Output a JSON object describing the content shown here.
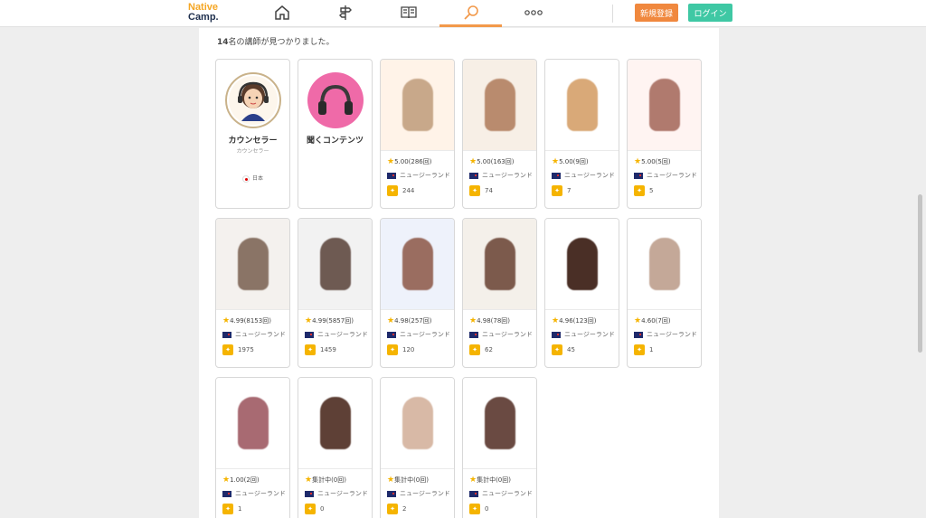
{
  "logo": {
    "line1": "Native",
    "line2": "Camp."
  },
  "nav": {
    "icons": [
      "home-icon",
      "signpost-icon",
      "book-icon",
      "search-icon",
      "more-icon"
    ]
  },
  "header": {
    "register_label": "新規登録",
    "login_label": "ログイン",
    "accent_color": "#f2994a",
    "login_color": "#3fc8a4"
  },
  "results": {
    "count": "14",
    "text": "名の講師が見つかりました。"
  },
  "counselor": {
    "name": "カウンセラー",
    "sub": "カウンセラー",
    "country": "日本"
  },
  "content_card": {
    "name": "聞くコンテンツ"
  },
  "teachers": [
    {
      "rating": "5.00(286回)",
      "country": "ニュージーランド",
      "bookmarks": "244"
    },
    {
      "rating": "5.00(163回)",
      "country": "ニュージーランド",
      "bookmarks": "74"
    },
    {
      "rating": "5.00(9回)",
      "country": "ニュージーランド",
      "bookmarks": "7"
    },
    {
      "rating": "5.00(5回)",
      "country": "ニュージーランド",
      "bookmarks": "5"
    },
    {
      "rating": "4.99(8153回)",
      "country": "ニュージーランド",
      "bookmarks": "1975"
    },
    {
      "rating": "4.99(5857回)",
      "country": "ニュージーランド",
      "bookmarks": "1459"
    },
    {
      "rating": "4.98(257回)",
      "country": "ニュージーランド",
      "bookmarks": "120"
    },
    {
      "rating": "4.98(78回)",
      "country": "ニュージーランド",
      "bookmarks": "62"
    },
    {
      "rating": "4.96(123回)",
      "country": "ニュージーランド",
      "bookmarks": "45"
    },
    {
      "rating": "4.60(7回)",
      "country": "ニュージーランド",
      "bookmarks": "1"
    },
    {
      "rating": "1.00(2回)",
      "country": "ニュージーランド",
      "bookmarks": "1"
    },
    {
      "rating": "集計中(0回)",
      "country": "ニュージーランド",
      "bookmarks": "0"
    },
    {
      "rating": "集計中(0回)",
      "country": "ニュージーランド",
      "bookmarks": "2"
    },
    {
      "rating": "集計中(0回)",
      "country": "ニュージーランド",
      "bookmarks": "0"
    }
  ]
}
